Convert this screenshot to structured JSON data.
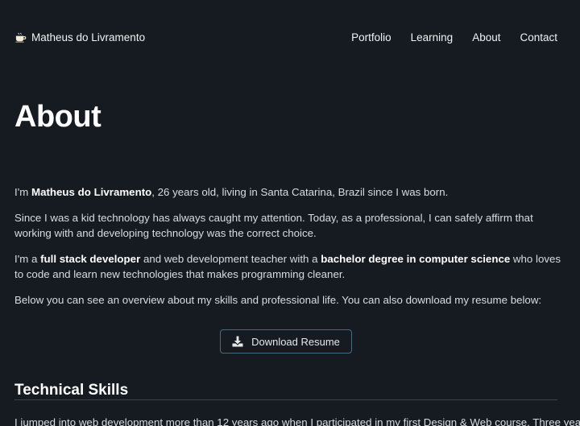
{
  "header": {
    "brand_icon": "coffee-icon",
    "brand_name": "Matheus do Livramento",
    "nav": [
      {
        "label": "Portfolio"
      },
      {
        "label": "Learning"
      },
      {
        "label": "About"
      },
      {
        "label": "Contact"
      }
    ]
  },
  "main": {
    "title": "About",
    "intro": {
      "prefix": "I'm ",
      "name": "Matheus do Livramento",
      "suffix": ", 26 years old, living in Santa Catarina, Brazil since I was born."
    },
    "paragraph2": "Since I was a kid technology has always caught my attention. Today, as a professional, I can safely affirm that working with and developing technology was the correct choice.",
    "paragraph3": {
      "prefix": "I'm a ",
      "role": "full stack developer",
      "middle": " and web development teacher with a ",
      "degree": "bachelor degree in computer science",
      "suffix": " who loves to code and learn new technologies that makes programming cleaner."
    },
    "paragraph4": "Below you can see an overview about my skills and professional life. You can also download my resume below:",
    "download": {
      "icon": "download-icon",
      "label": "Download Resume"
    },
    "skills": {
      "title": "Technical Skills",
      "text": "I jumped into web development more than 12 years ago when I participated in my first Design & Web course. Three years"
    }
  },
  "colors": {
    "background": "#161b22",
    "text": "#d9dcdf",
    "heading": "#ffffff",
    "button_border": "#4a6a80",
    "divider": "#39424c"
  }
}
